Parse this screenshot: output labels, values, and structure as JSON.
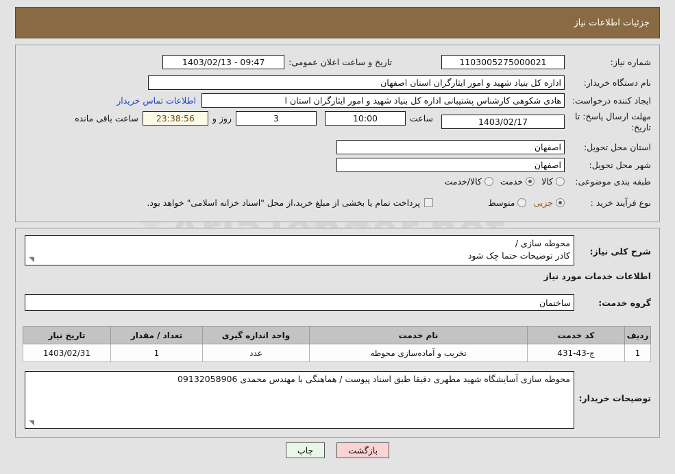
{
  "header": {
    "title": "جزئیات اطلاعات نیاز"
  },
  "watermark": {
    "text": "AriaTender.net"
  },
  "fields": {
    "need_number_label": "شماره نیاز:",
    "need_number_value": "1103005275000021",
    "announce_label": "تاریخ و ساعت اعلان عمومی:",
    "announce_value": "09:47 - 1403/02/13",
    "buyer_org_label": "نام دستگاه خریدار:",
    "buyer_org_value": "اداره کل بنیاد شهید و امور ایثارگران استان اصفهان",
    "creator_label": "ایجاد کننده درخواست:",
    "creator_value": "هادی شکوهی کارشناس پشتیبانی اداره کل بنیاد شهید و امور ایثارگران استان ا",
    "contact_link": "اطلاعات تماس خریدار",
    "deadline_label": "مهلت ارسال پاسخ: تا تاریخ:",
    "deadline_date": "1403/02/17",
    "deadline_hour_label": "ساعت",
    "deadline_hour_value": "10:00",
    "remaining_days": "3",
    "remaining_days_label": "روز و",
    "remaining_time": "23:38:56",
    "remaining_suffix": "ساعت باقی مانده",
    "province_label": "استان محل تحویل:",
    "province_value": "اصفهان",
    "city_label": "شهر محل تحویل:",
    "city_value": "اصفهان",
    "category_label": "طبقه بندی موضوعی:",
    "process_label": "نوع فرآیند خرید :",
    "treasury_note": "پرداخت تمام یا بخشی از مبلغ خرید،از محل \"اسناد خزانه اسلامی\" خواهد بود."
  },
  "category_options": [
    {
      "label": "کالا",
      "selected": false
    },
    {
      "label": "خدمت",
      "selected": true
    },
    {
      "label": "کالا/خدمت",
      "selected": false
    }
  ],
  "process_options": [
    {
      "label": "جزیی",
      "selected": true
    },
    {
      "label": "متوسط",
      "selected": false
    }
  ],
  "description": {
    "label": "شرح کلی نیاز:",
    "line1": "محوطه سازی /",
    "line2": "کادر توضیحات حتما چک شود"
  },
  "services_section": {
    "title": "اطلاعات خدمات مورد نیاز",
    "group_label": "گروه خدمت:",
    "group_value": "ساختمان"
  },
  "table": {
    "headers": [
      "ردیف",
      "کد خدمت",
      "نام خدمت",
      "واحد اندازه گیری",
      "تعداد / مقدار",
      "تاریخ نیاز"
    ],
    "rows": [
      {
        "index": "1",
        "code": "ج-43-431",
        "name": "تخریب و آماده‌سازی محوطه",
        "unit": "عدد",
        "quantity": "1",
        "need_date": "1403/02/31"
      }
    ]
  },
  "buyer_notes": {
    "label": "توضیحات خریدار:",
    "value": "محوطه سازی آسایشگاه شهید مطهری دقیقا طبق اسناد پیوست / هماهنگی با مهندس محمدی 09132058906"
  },
  "buttons": {
    "print": "چاپ",
    "back": "بازگشت"
  },
  "colors": {
    "header_bg": "#8a6a42",
    "page_bg": "#e3e3e3",
    "link": "#1745c9",
    "selected_radio_text": "#8a5a15",
    "countdown_bg": "#fbfbe8",
    "print_btn_bg": "#e9f7e9",
    "back_btn_bg": "#fbd3d3"
  }
}
